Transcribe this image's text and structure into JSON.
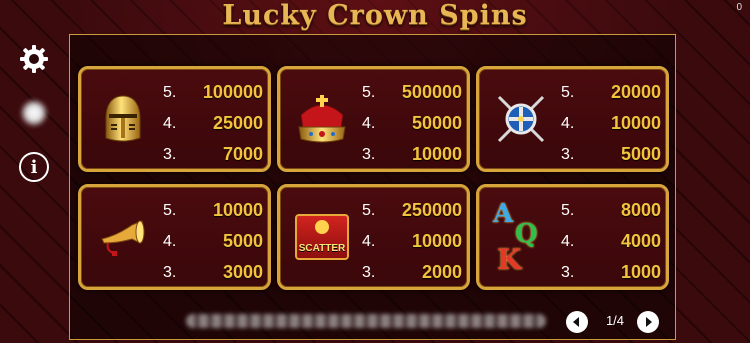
{
  "game": {
    "title": "Lucky Crown Spins",
    "corner_value": "0"
  },
  "paytable": [
    {
      "symbol": "knight-helmet",
      "rows": [
        {
          "count": "5.",
          "payout": "100000"
        },
        {
          "count": "4.",
          "payout": "25000"
        },
        {
          "count": "3.",
          "payout": "7000"
        }
      ]
    },
    {
      "symbol": "crown",
      "rows": [
        {
          "count": "5.",
          "payout": "500000"
        },
        {
          "count": "4.",
          "payout": "50000"
        },
        {
          "count": "3.",
          "payout": "10000"
        }
      ]
    },
    {
      "symbol": "shield-swords",
      "rows": [
        {
          "count": "5.",
          "payout": "20000"
        },
        {
          "count": "4.",
          "payout": "10000"
        },
        {
          "count": "3.",
          "payout": "5000"
        }
      ]
    },
    {
      "symbol": "horn",
      "rows": [
        {
          "count": "5.",
          "payout": "10000"
        },
        {
          "count": "4.",
          "payout": "5000"
        },
        {
          "count": "3.",
          "payout": "3000"
        }
      ]
    },
    {
      "symbol": "scatter",
      "label": "SCATTER",
      "rows": [
        {
          "count": "5.",
          "payout": "250000"
        },
        {
          "count": "4.",
          "payout": "10000"
        },
        {
          "count": "3.",
          "payout": "2000"
        }
      ]
    },
    {
      "symbol": "letters-a-q-k",
      "letters": [
        "A",
        "Q",
        "K"
      ],
      "rows": [
        {
          "count": "5.",
          "payout": "8000"
        },
        {
          "count": "4.",
          "payout": "4000"
        },
        {
          "count": "3.",
          "payout": "1000"
        }
      ]
    }
  ],
  "pagination": {
    "label": "1/4"
  },
  "colors": {
    "gold": "#f2c33c",
    "border": "#d8a43c",
    "card_bg": "#4a0b0e"
  }
}
